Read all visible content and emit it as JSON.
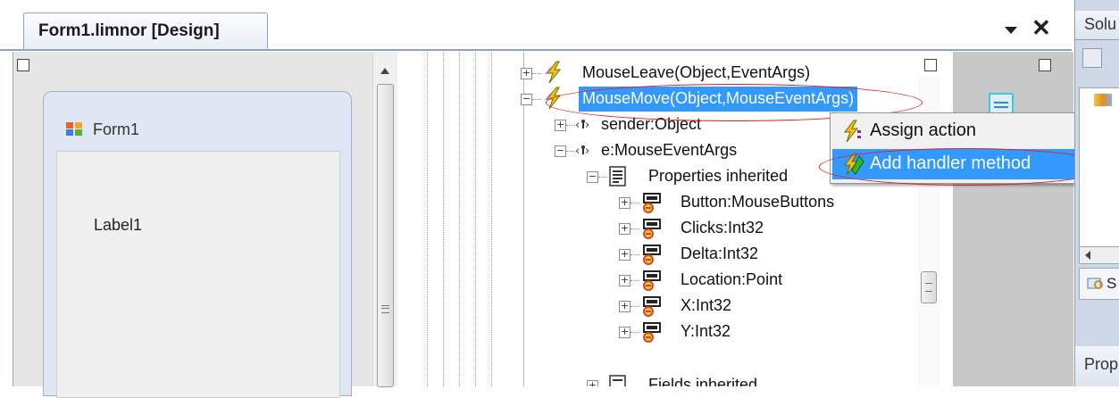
{
  "tab": {
    "title": "Form1.limnor [Design]"
  },
  "form": {
    "title": "Form1",
    "label": "Label1"
  },
  "tree": [
    {
      "label": "MouseLeave(Object,EventArgs)",
      "icon": "lightning-icon"
    },
    {
      "label": "MouseMove(Object,MouseEventArgs)",
      "icon": "lightning-icon",
      "selected": true
    },
    {
      "label": "sender:Object",
      "icon": "parameter-icon"
    },
    {
      "label": "e:MouseEventArgs",
      "icon": "parameter-icon"
    },
    {
      "label": "Properties inherited",
      "icon": "properties-icon"
    },
    {
      "label": "Button:MouseButtons",
      "icon": "property-icon"
    },
    {
      "label": "Clicks:Int32",
      "icon": "property-icon"
    },
    {
      "label": "Delta:Int32",
      "icon": "property-icon"
    },
    {
      "label": "Location:Point",
      "icon": "property-icon"
    },
    {
      "label": "X:Int32",
      "icon": "property-icon"
    },
    {
      "label": "Y:Int32",
      "icon": "property-icon"
    },
    {
      "label": "Fields inherited",
      "icon": "fields-icon"
    }
  ],
  "context_menu": [
    {
      "label": "Assign action",
      "icon": "assign-action-icon"
    },
    {
      "label": "Add handler method",
      "icon": "add-handler-icon",
      "highlighted": true
    }
  ],
  "right_panel": {
    "solution_header": "Solu",
    "properties_header": "Prop",
    "partial_label": "S"
  },
  "colors": {
    "selection": "#3399ff",
    "annotation": "#e02020",
    "tab_border": "#8da3c1"
  }
}
